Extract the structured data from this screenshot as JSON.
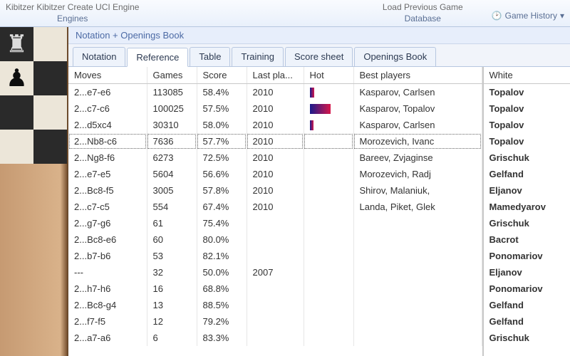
{
  "ribbon": {
    "group1_top": "Kibitzer Kibitzer    Create UCI Engine",
    "group1_label": "Engines",
    "group2_top": "Load Previous Game",
    "group2_label": "Database",
    "game_history": "Game History"
  },
  "panel_title": "Notation + Openings Book",
  "tabs": [
    "Notation",
    "Reference",
    "Table",
    "Training",
    "Score sheet",
    "Openings Book"
  ],
  "active_tab": 1,
  "columns": [
    "Moves",
    "Games",
    "Score",
    "Last pla...",
    "Hot",
    "Best players"
  ],
  "rows": [
    {
      "move": "2...e7-e6",
      "games": "113085",
      "score": "58.4%",
      "last": "2010",
      "hot": 0.12,
      "best": "Kasparov, Carlsen"
    },
    {
      "move": "2...c7-c6",
      "games": "100025",
      "score": "57.5%",
      "last": "2010",
      "hot": 0.55,
      "best": "Kasparov, Topalov"
    },
    {
      "move": "2...d5xc4",
      "games": "30310",
      "score": "58.0%",
      "last": "2010",
      "hot": 0.1,
      "best": "Kasparov, Carlsen"
    },
    {
      "move": "2...Nb8-c6",
      "games": "7636",
      "score": "57.7%",
      "last": "2010",
      "hot": 0,
      "best": "Morozevich, Ivanc",
      "sel": true
    },
    {
      "move": "2...Ng8-f6",
      "games": "6273",
      "score": "72.5%",
      "last": "2010",
      "hot": 0,
      "best": "Bareev, Zvjaginse"
    },
    {
      "move": "2...e7-e5",
      "games": "5604",
      "score": "56.6%",
      "last": "2010",
      "hot": 0,
      "best": "Morozevich, Radj"
    },
    {
      "move": "2...Bc8-f5",
      "games": "3005",
      "score": "57.8%",
      "last": "2010",
      "hot": 0,
      "best": "Shirov, Malaniuk,"
    },
    {
      "move": "2...c7-c5",
      "games": "554",
      "score": "67.4%",
      "last": "2010",
      "hot": 0,
      "best": "Landa, Piket, Glek"
    },
    {
      "move": "2...g7-g6",
      "games": "61",
      "score": "75.4%",
      "last": "",
      "hot": 0,
      "best": ""
    },
    {
      "move": "2...Bc8-e6",
      "games": "60",
      "score": "80.0%",
      "last": "",
      "hot": 0,
      "best": ""
    },
    {
      "move": "2...b7-b6",
      "games": "53",
      "score": "82.1%",
      "last": "",
      "hot": 0,
      "best": ""
    },
    {
      "move": "---",
      "games": "32",
      "score": "50.0%",
      "last": "2007",
      "hot": 0,
      "best": ""
    },
    {
      "move": "2...h7-h6",
      "games": "16",
      "score": "68.8%",
      "last": "",
      "hot": 0,
      "best": ""
    },
    {
      "move": "2...Bc8-g4",
      "games": "13",
      "score": "88.5%",
      "last": "",
      "hot": 0,
      "best": ""
    },
    {
      "move": "2...f7-f5",
      "games": "12",
      "score": "79.2%",
      "last": "",
      "hot": 0,
      "best": ""
    },
    {
      "move": "2...a7-a6",
      "games": "6",
      "score": "83.3%",
      "last": "",
      "hot": 0,
      "best": ""
    }
  ],
  "white_header": "White",
  "white_players": [
    "Topalov",
    "Topalov",
    "Topalov",
    "Topalov",
    "Grischuk",
    "Gelfand",
    "Eljanov",
    "Mamedyarov",
    "Grischuk",
    "Bacrot",
    "Ponomariov",
    "Eljanov",
    "Ponomariov",
    "Gelfand",
    "Gelfand",
    "Grischuk"
  ],
  "pieces": {
    "rook": "♜",
    "pawn": "♟"
  }
}
